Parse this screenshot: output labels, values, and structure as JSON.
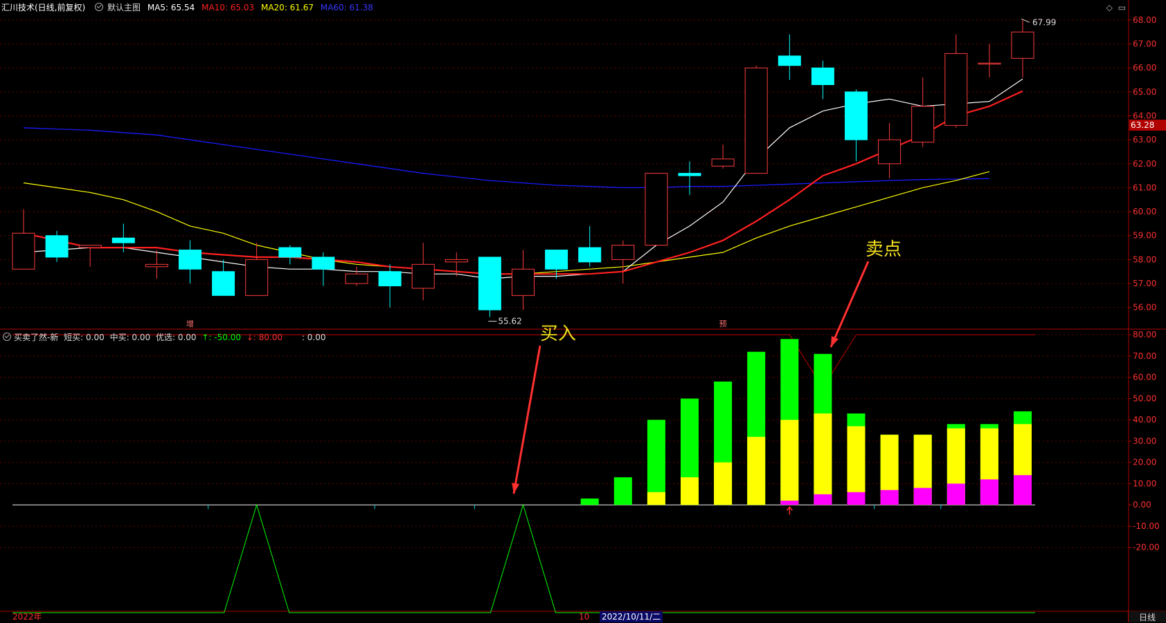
{
  "header": {
    "title": "汇川技术(日线,前复权)",
    "main_chart_name": "默认主图",
    "ma5": "MA5: 65.54",
    "ma10": "MA10: 65.03",
    "ma20": "MA20: 61.67",
    "ma60": "MA60: 61.38",
    "icons": [
      "diamond-icon",
      "window-icon"
    ]
  },
  "indicator": {
    "name": "买卖了然-新",
    "short_buy": "短买: 0.00",
    "mid_buy": "中买: 0.00",
    "select": "优选: 0.00",
    "up_label": "↑: -50.00",
    "down_label": "↓: 80.00",
    "extra": ": 0.00"
  },
  "annotations": {
    "buy": "买入",
    "sell": "卖点"
  },
  "markers": {
    "high_label": "67.99",
    "low_label": "55.62",
    "mark1": "增",
    "mark2": "预"
  },
  "price_axis": {
    "ticks": [
      "68.00",
      "67.00",
      "66.00",
      "65.00",
      "64.00",
      "63.00",
      "62.00",
      "61.00",
      "60.00",
      "59.00",
      "58.00",
      "57.00",
      "56.00"
    ],
    "current": "63.28"
  },
  "ind_axis": {
    "ticks": [
      "80.00",
      "70.00",
      "60.00",
      "50.00",
      "40.00",
      "30.00",
      "20.00",
      "10.00",
      "0.00",
      "-10.00",
      "-20.00"
    ]
  },
  "bottom": {
    "year": "2022年",
    "month": "10",
    "date": "2022/10/11/二",
    "period": "日线"
  },
  "colors": {
    "up": "#ff3c3c",
    "down": "#00ffff",
    "ma5": "#ffffff",
    "ma10": "#ff2020",
    "ma20": "#ffff00",
    "ma60": "#1a1aff",
    "green": "#00ff00",
    "yellow": "#ffff00",
    "magenta": "#ff00ff"
  },
  "chart_data": {
    "type": "candlestick",
    "ylim": [
      55.5,
      68.2
    ],
    "candles": [
      {
        "o": 57.6,
        "c": 59.1,
        "h": 60.1,
        "l": 57.6
      },
      {
        "o": 59.0,
        "c": 58.1,
        "h": 59.2,
        "l": 57.9
      },
      {
        "o": 58.5,
        "c": 58.6,
        "h": 58.6,
        "l": 57.7
      },
      {
        "o": 58.9,
        "c": 58.7,
        "h": 59.5,
        "l": 58.3
      },
      {
        "o": 57.7,
        "c": 57.8,
        "h": 58.4,
        "l": 57.2
      },
      {
        "o": 58.4,
        "c": 57.6,
        "h": 58.8,
        "l": 57.0
      },
      {
        "o": 57.5,
        "c": 56.5,
        "h": 58.0,
        "l": 56.5
      },
      {
        "o": 56.5,
        "c": 58.0,
        "h": 58.7,
        "l": 56.5
      },
      {
        "o": 58.5,
        "c": 58.1,
        "h": 58.6,
        "l": 57.8
      },
      {
        "o": 58.1,
        "c": 57.6,
        "h": 58.3,
        "l": 56.9
      },
      {
        "o": 57.0,
        "c": 57.4,
        "h": 57.7,
        "l": 56.9
      },
      {
        "o": 57.5,
        "c": 56.9,
        "h": 57.8,
        "l": 56.0
      },
      {
        "o": 56.8,
        "c": 57.8,
        "h": 58.7,
        "l": 56.3
      },
      {
        "o": 57.9,
        "c": 58.0,
        "h": 58.3,
        "l": 57.3
      },
      {
        "o": 58.1,
        "c": 55.9,
        "h": 58.1,
        "l": 55.6
      },
      {
        "o": 56.5,
        "c": 57.6,
        "h": 58.4,
        "l": 55.9
      },
      {
        "o": 58.4,
        "c": 57.6,
        "h": 58.4,
        "l": 57.2
      },
      {
        "o": 58.5,
        "c": 57.9,
        "h": 59.4,
        "l": 57.7
      },
      {
        "o": 58.0,
        "c": 58.6,
        "h": 58.8,
        "l": 57.0
      },
      {
        "o": 58.6,
        "c": 61.6,
        "h": 61.6,
        "l": 58.6
      },
      {
        "o": 61.6,
        "c": 61.5,
        "h": 62.1,
        "l": 60.7
      },
      {
        "o": 61.9,
        "c": 62.2,
        "h": 62.8,
        "l": 61.8
      },
      {
        "o": 61.6,
        "c": 66.0,
        "h": 66.1,
        "l": 61.6
      },
      {
        "o": 66.5,
        "c": 66.1,
        "h": 67.4,
        "l": 65.5
      },
      {
        "o": 66.0,
        "c": 65.3,
        "h": 66.3,
        "l": 64.7
      },
      {
        "o": 65.0,
        "c": 63.0,
        "h": 65.1,
        "l": 62.1
      },
      {
        "o": 62.0,
        "c": 63.0,
        "h": 63.7,
        "l": 61.4
      },
      {
        "o": 62.9,
        "c": 64.4,
        "h": 65.6,
        "l": 62.7
      },
      {
        "o": 63.6,
        "c": 66.6,
        "h": 67.4,
        "l": 63.5
      },
      {
        "o": 66.2,
        "c": 66.2,
        "h": 67.0,
        "l": 65.6
      },
      {
        "o": 66.4,
        "c": 67.5,
        "h": 67.99,
        "l": 65.6
      }
    ],
    "ma5": [
      58.3,
      58.4,
      58.5,
      58.5,
      58.3,
      58.1,
      57.9,
      57.7,
      57.6,
      57.6,
      57.5,
      57.5,
      57.4,
      57.4,
      57.2,
      57.3,
      57.3,
      57.4,
      57.5,
      58.6,
      59.4,
      60.4,
      62.2,
      63.5,
      64.2,
      64.5,
      64.7,
      64.4,
      64.5,
      64.6,
      65.54
    ],
    "ma10": [
      59.1,
      58.8,
      58.5,
      58.5,
      58.5,
      58.3,
      58.2,
      58.1,
      58.1,
      58.0,
      57.9,
      57.7,
      57.6,
      57.5,
      57.4,
      57.4,
      57.4,
      57.4,
      57.5,
      57.9,
      58.3,
      58.8,
      59.6,
      60.5,
      61.5,
      62.0,
      62.6,
      63.2,
      64.0,
      64.4,
      65.03
    ],
    "ma20": [
      61.2,
      61.0,
      60.8,
      60.5,
      60.0,
      59.4,
      59.1,
      58.6,
      58.3,
      58.0,
      57.8,
      57.7,
      57.6,
      57.5,
      57.4,
      57.4,
      57.5,
      57.6,
      57.7,
      57.9,
      58.1,
      58.3,
      58.9,
      59.4,
      59.8,
      60.2,
      60.6,
      61.0,
      61.3,
      61.67
    ],
    "ma60": [
      63.5,
      63.45,
      63.4,
      63.3,
      63.2,
      63.0,
      62.8,
      62.6,
      62.4,
      62.2,
      62.0,
      61.8,
      61.6,
      61.45,
      61.3,
      61.2,
      61.1,
      61.05,
      61.0,
      61.0,
      61.05,
      61.05,
      61.1,
      61.15,
      61.2,
      61.25,
      61.3,
      61.34,
      61.36,
      61.38
    ],
    "indicator_bars": [
      {
        "i": 17,
        "green": 3,
        "yellow": 0,
        "magenta": 0
      },
      {
        "i": 18,
        "green": 13,
        "yellow": 0,
        "magenta": 0
      },
      {
        "i": 19,
        "green": 40,
        "yellow": 6,
        "magenta": 0
      },
      {
        "i": 20,
        "green": 50,
        "yellow": 13,
        "magenta": 0
      },
      {
        "i": 21,
        "green": 58,
        "yellow": 20,
        "magenta": 0
      },
      {
        "i": 22,
        "green": 72,
        "yellow": 32,
        "magenta": 0
      },
      {
        "i": 23,
        "green": 78,
        "yellow": 40,
        "magenta": 2
      },
      {
        "i": 24,
        "green": 71,
        "yellow": 43,
        "magenta": 5
      },
      {
        "i": 25,
        "green": 43,
        "yellow": 37,
        "magenta": 6
      },
      {
        "i": 26,
        "green": 33,
        "yellow": 33,
        "magenta": 7
      },
      {
        "i": 27,
        "green": 33,
        "yellow": 33,
        "magenta": 8
      },
      {
        "i": 28,
        "green": 38,
        "yellow": 36,
        "magenta": 10
      },
      {
        "i": 29,
        "green": 38,
        "yellow": 36,
        "magenta": 12
      },
      {
        "i": 30,
        "green": 44,
        "yellow": 38,
        "magenta": 14
      }
    ],
    "indicator_peaks": [
      7,
      15
    ],
    "ind_ylim": [
      -50,
      82
    ]
  }
}
